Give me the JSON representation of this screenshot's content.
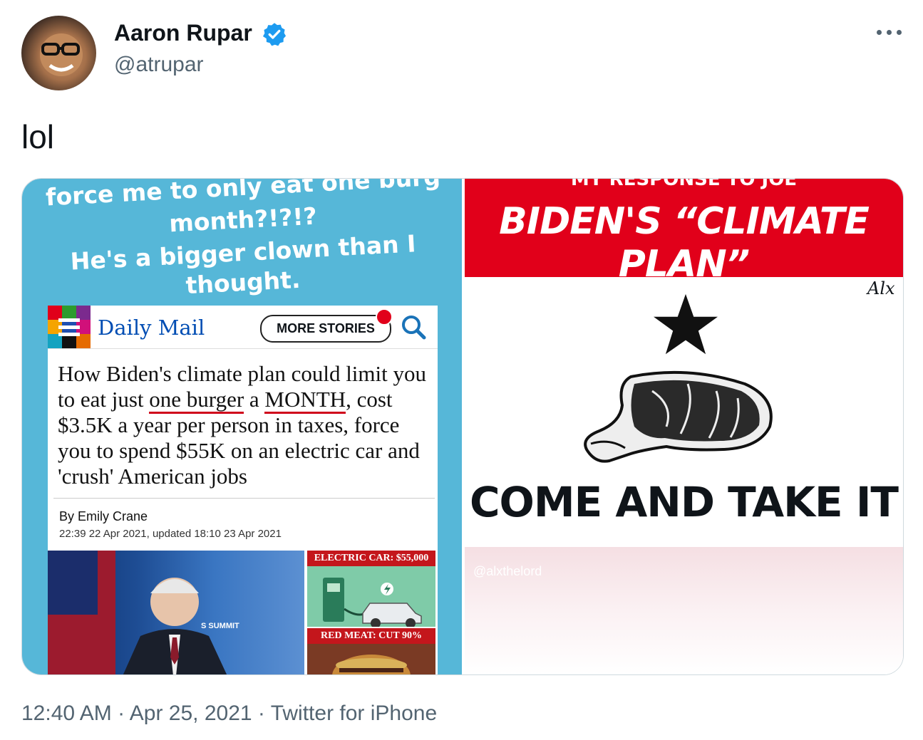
{
  "author": {
    "name": "Aaron Rupar",
    "handle": "@atrupar",
    "verified": true
  },
  "tweet": {
    "text": "lol"
  },
  "media": {
    "left_image": {
      "story_lines": [
        "force me to only eat one burg",
        "month?!?!?",
        "He's a bigger clown than I",
        "thought."
      ],
      "daily_mail": {
        "logo_text": "Daily Mail",
        "more_stories_label": "MORE STORIES",
        "headline_part1": "How Biden's climate plan could limit you to eat just ",
        "headline_underline1": "one burger",
        "headline_part2": " a ",
        "headline_underline2": "MONTH",
        "headline_part3": ", cost $3.5K a year per person in taxes, force you to spend $55K on an electric car and 'crush' American jobs",
        "byline": "By Emily Crane",
        "date": "22:39 22 Apr 2021, updated 18:10 23 Apr 2021",
        "tag_electric": "ELECTRIC CAR: $55,000",
        "tag_meat": "RED MEAT: CUT 90%",
        "photo_caption": "S SUMMIT"
      }
    },
    "right_image": {
      "top_text": "MY RESPONSE TO JOE",
      "title": "BIDEN'S “CLIMATE PLAN”",
      "signature": "Alx",
      "slogan": "COME AND TAKE IT",
      "watermark": "@alxthelord"
    }
  },
  "footer": {
    "time": "12:40 AM",
    "date": "Apr 25, 2021",
    "source": "Twitter for iPhone"
  },
  "colors": {
    "verified_blue": "#1d9bf0",
    "daily_mail_blue": "#004db3",
    "flag_red": "#e1001a",
    "story_bg": "#56b7d8"
  }
}
